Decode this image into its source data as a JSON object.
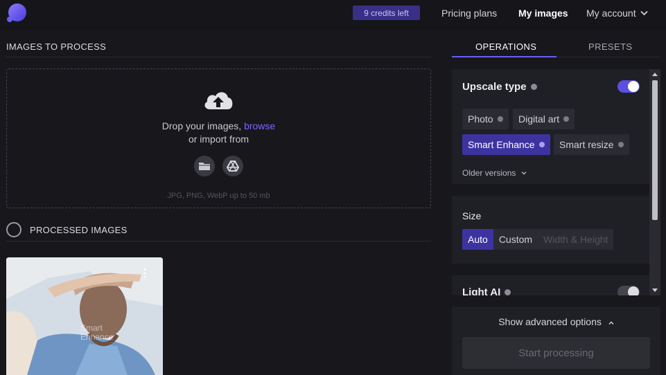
{
  "nav": {
    "credits": "9 credits left",
    "pricing": "Pricing plans",
    "my_images": "My images",
    "account": "My account"
  },
  "left": {
    "images_title": "IMAGES TO PROCESS",
    "drop_text": "Drop your images,",
    "browse": "browse",
    "import_text": "or import from",
    "formats": "JPG, PNG, WebP up to 50 mb",
    "processed_title": "PROCESSED IMAGES",
    "thumb_label_1": "Smart",
    "thumb_label_2": "Enhance"
  },
  "tabs": {
    "operations": "OPERATIONS",
    "presets": "PRESETS"
  },
  "upscale": {
    "title": "Upscale type",
    "enabled": true,
    "options": [
      "Photo",
      "Digital art",
      "Smart Enhance",
      "Smart resize"
    ],
    "selected": "Smart Enhance",
    "older": "Older versions"
  },
  "size": {
    "title": "Size",
    "options": [
      "Auto",
      "Custom",
      "Width & Height"
    ],
    "selected": "Auto"
  },
  "light_ai": {
    "title": "Light AI",
    "enabled": false
  },
  "bottom": {
    "advanced": "Show advanced options",
    "start": "Start processing"
  },
  "colors": {
    "accent": "#5b4fe0",
    "selected_chip": "#3d33a0",
    "link": "#7a68ff"
  }
}
